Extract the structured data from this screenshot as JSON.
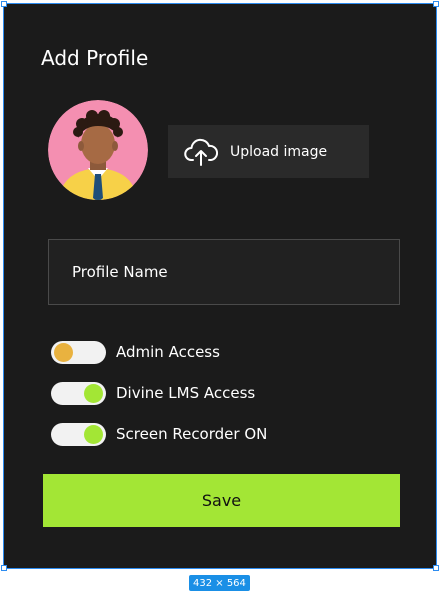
{
  "dialog": {
    "title": "Add Profile",
    "upload_label": "Upload image",
    "name_placeholder": "Profile Name",
    "save_label": "Save"
  },
  "toggles": [
    {
      "label": "Admin Access",
      "state": "off",
      "knob_color": "#e9b23f"
    },
    {
      "label": "Divine LMS Access",
      "state": "on",
      "knob_color": "#a3e635"
    },
    {
      "label": "Screen Recorder ON",
      "state": "on",
      "knob_color": "#a3e635"
    }
  ],
  "frame_size_label": "432 × 564",
  "colors": {
    "background": "#1b1b1b",
    "accent": "#a3e635",
    "off_knob": "#e9b23f",
    "avatar_bg": "#f48fb1"
  }
}
